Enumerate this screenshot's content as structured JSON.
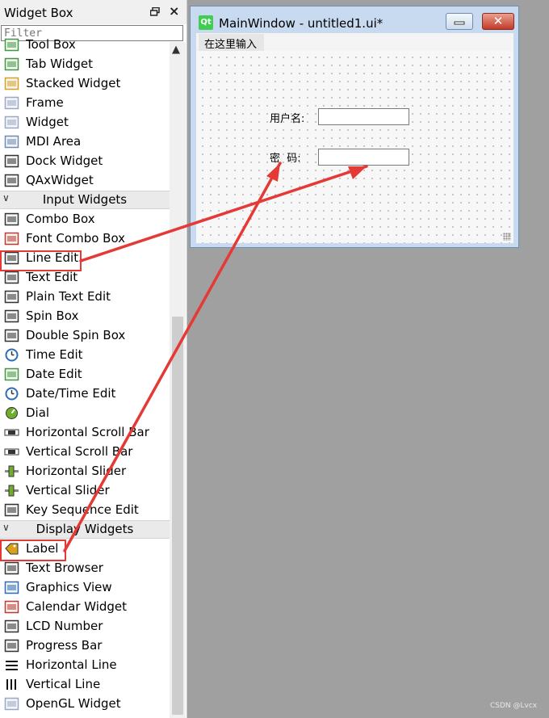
{
  "widget_box": {
    "title": "Widget Box",
    "float_icon": "float-icon",
    "close_icon": "×",
    "filter_placeholder": "Filter",
    "scroll_up": "▲"
  },
  "items": [
    {
      "name": "Tool Box",
      "icon": "toolbox-icon",
      "color": "#3e9a3e"
    },
    {
      "name": "Tab Widget",
      "icon": "tab-widget-icon",
      "color": "#3e9a3e"
    },
    {
      "name": "Stacked Widget",
      "icon": "stacked-widget-icon",
      "color": "#d8a11c"
    },
    {
      "name": "Frame",
      "icon": "frame-icon",
      "color": "#9aa7c8"
    },
    {
      "name": "Widget",
      "icon": "widget-icon",
      "color": "#9aa7c8"
    },
    {
      "name": "MDI Area",
      "icon": "mdi-area-icon",
      "color": "#6c8ab5"
    },
    {
      "name": "Dock Widget",
      "icon": "dock-widget-icon",
      "color": "#333333"
    },
    {
      "name": "QAxWidget",
      "icon": "qaxwidget-icon",
      "color": "#333333"
    },
    {
      "category": "Input Widgets"
    },
    {
      "name": "Combo Box",
      "icon": "combo-box-icon",
      "color": "#333333"
    },
    {
      "name": "Font Combo Box",
      "icon": "font-combo-box-icon",
      "color": "#c0392b"
    },
    {
      "name": "Line Edit",
      "icon": "line-edit-icon",
      "color": "#333333"
    },
    {
      "name": "Text Edit",
      "icon": "text-edit-icon",
      "color": "#333333"
    },
    {
      "name": "Plain Text Edit",
      "icon": "plain-text-edit-icon",
      "color": "#333333"
    },
    {
      "name": "Spin Box",
      "icon": "spin-box-icon",
      "color": "#333333"
    },
    {
      "name": "Double Spin Box",
      "icon": "double-spin-box-icon",
      "color": "#333333"
    },
    {
      "name": "Time Edit",
      "icon": "time-edit-icon",
      "color": "#2c6db5"
    },
    {
      "name": "Date Edit",
      "icon": "date-edit-icon",
      "color": "#3e9a3e"
    },
    {
      "name": "Date/Time Edit",
      "icon": "date-time-edit-icon",
      "color": "#2c6db5"
    },
    {
      "name": "Dial",
      "icon": "dial-icon",
      "color": "#6fae2c"
    },
    {
      "name": "Horizontal Scroll Bar",
      "icon": "horizontal-scroll-bar-icon",
      "color": "#333333"
    },
    {
      "name": "Vertical Scroll Bar",
      "icon": "vertical-scroll-bar-icon",
      "color": "#333333"
    },
    {
      "name": "Horizontal Slider",
      "icon": "horizontal-slider-icon",
      "color": "#6fae2c"
    },
    {
      "name": "Vertical Slider",
      "icon": "vertical-slider-icon",
      "color": "#6fae2c"
    },
    {
      "name": "Key Sequence Edit",
      "icon": "key-sequence-edit-icon",
      "color": "#333333"
    },
    {
      "category": "Display Widgets"
    },
    {
      "name": "Label",
      "icon": "label-icon",
      "color": "#d8a11c"
    },
    {
      "name": "Text Browser",
      "icon": "text-browser-icon",
      "color": "#333333"
    },
    {
      "name": "Graphics View",
      "icon": "graphics-view-icon",
      "color": "#2c6db5"
    },
    {
      "name": "Calendar Widget",
      "icon": "calendar-widget-icon",
      "color": "#c0392b"
    },
    {
      "name": "LCD Number",
      "icon": "lcd-number-icon",
      "color": "#333333"
    },
    {
      "name": "Progress Bar",
      "icon": "progress-bar-icon",
      "color": "#333333"
    },
    {
      "name": "Horizontal Line",
      "icon": "horizontal-line-icon",
      "color": "#111111"
    },
    {
      "name": "Vertical Line",
      "icon": "vertical-line-icon",
      "color": "#111111"
    },
    {
      "name": "OpenGL Widget",
      "icon": "opengl-widget-icon",
      "color": "#9aa7c8"
    }
  ],
  "main_window": {
    "title": "MainWindow - untitled1.ui*",
    "qt_logo": "Qt",
    "menu_placeholder": "在这里输入",
    "username_label": "用户名:",
    "password_label": "密  码:",
    "close_glyph": "✕"
  },
  "annotation": {
    "color": "#e53935"
  },
  "watermark": "CSDN @Lvcx"
}
